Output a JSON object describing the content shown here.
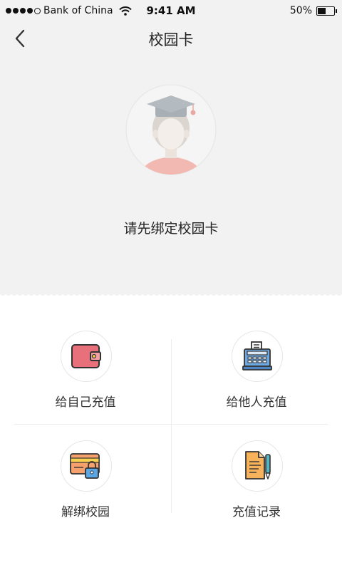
{
  "status_bar": {
    "carrier": "Bank of China",
    "time": "9:41 AM",
    "battery": "50%"
  },
  "nav": {
    "title": "校园卡",
    "back_icon": "chevron-left-icon"
  },
  "profile": {
    "prompt": "请先绑定校园卡",
    "avatar_icon": "graduate-avatar-icon"
  },
  "actions": [
    {
      "label": "给自己充值",
      "icon": "wallet-icon"
    },
    {
      "label": "给他人充值",
      "icon": "cash-register-icon"
    },
    {
      "label": "解绑校园",
      "icon": "card-lock-icon"
    },
    {
      "label": "充值记录",
      "icon": "document-pen-icon"
    }
  ],
  "colors": {
    "header_bg": "#f2f2f2",
    "wallet": "#e8707a",
    "register": "#6ea8e0",
    "card": "#f6a16b",
    "lock": "#5aa7e6",
    "document": "#f6b35b",
    "pen": "#56b5c2"
  }
}
